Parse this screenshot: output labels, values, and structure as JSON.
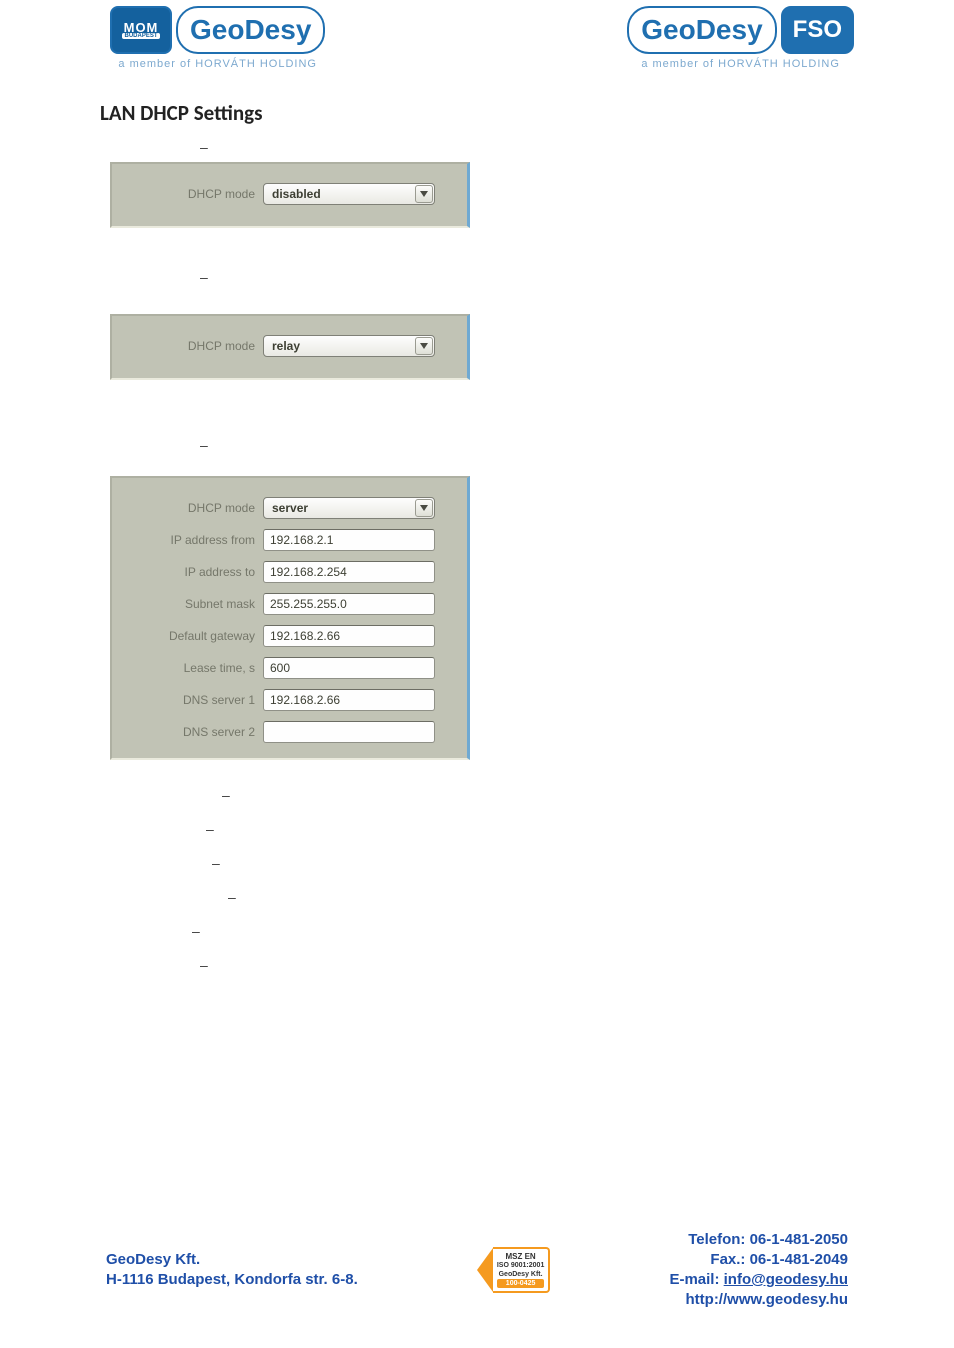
{
  "header": {
    "left_logo_mom_top": "MOM",
    "left_logo_mom_sub": "BUDAPEST",
    "geodesy_word": "GeoDesy",
    "fso_word": "FSO",
    "tagline": "a member of HORVÁTH HOLDING"
  },
  "title": "LAN DHCP Settings",
  "panel1": {
    "dhcp_mode_label": "DHCP mode",
    "dhcp_mode_value": "disabled"
  },
  "panel2": {
    "dhcp_mode_label": "DHCP mode",
    "dhcp_mode_value": "relay"
  },
  "panel3": {
    "dhcp_mode_label": "DHCP mode",
    "dhcp_mode_value": "server",
    "rows": [
      {
        "label": "IP address from",
        "value": "192.168.2.1"
      },
      {
        "label": "IP address to",
        "value": "192.168.2.254"
      },
      {
        "label": "Subnet mask",
        "value": "255.255.255.0"
      },
      {
        "label": "Default gateway",
        "value": "192.168.2.66"
      },
      {
        "label": "Lease time, s",
        "value": "600"
      },
      {
        "label": "DNS server 1",
        "value": "192.168.2.66"
      },
      {
        "label": "DNS server 2",
        "value": ""
      }
    ]
  },
  "dashes_above": [
    "–",
    "–",
    "–"
  ],
  "dashes_below": [
    "–",
    "–",
    "–",
    "–",
    "–",
    "–"
  ],
  "footer": {
    "company": "GeoDesy Kft.",
    "address": "H-1116 Budapest, Kondorfa str. 6-8.",
    "phone": "Telefon: 06-1-481-2050",
    "fax": "Fax.: 06-1-481-2049",
    "email_label": "E-mail: ",
    "email": "info@geodesy.hu",
    "web": "http://www.geodesy.hu",
    "cert_lines": [
      "MSZ EN",
      "ISO 9001:2001",
      "GeoDesy Kft.",
      "100-0425"
    ]
  }
}
